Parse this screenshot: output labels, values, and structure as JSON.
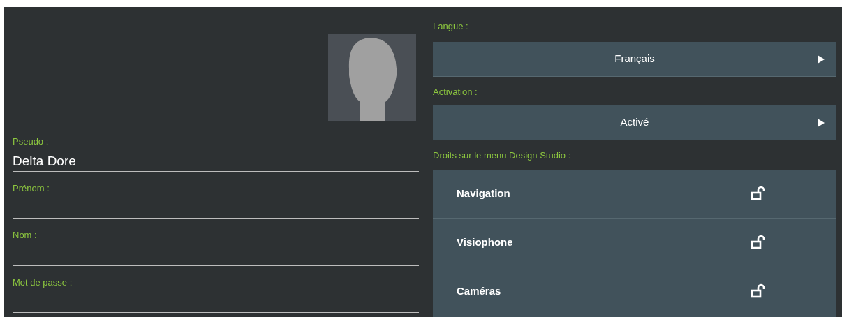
{
  "profile": {
    "fields": [
      {
        "label": "Pseudo :",
        "value": "Delta Dore",
        "kind": "text"
      },
      {
        "label": "Prénom :",
        "kind": "text"
      },
      {
        "label": "Nom :",
        "kind": "text"
      },
      {
        "label": "Mot de passe :",
        "kind": "password"
      }
    ]
  },
  "settings": {
    "language": {
      "label": "Langue :",
      "value": "Français"
    },
    "activation": {
      "label": "Activation :",
      "value": "Activé"
    },
    "rights": {
      "label": "Droits sur le menu Design Studio :",
      "items": [
        {
          "label": "Navigation",
          "locked": false
        },
        {
          "label": "Visiophone",
          "locked": false
        },
        {
          "label": "Caméras",
          "locked": false
        }
      ]
    }
  }
}
